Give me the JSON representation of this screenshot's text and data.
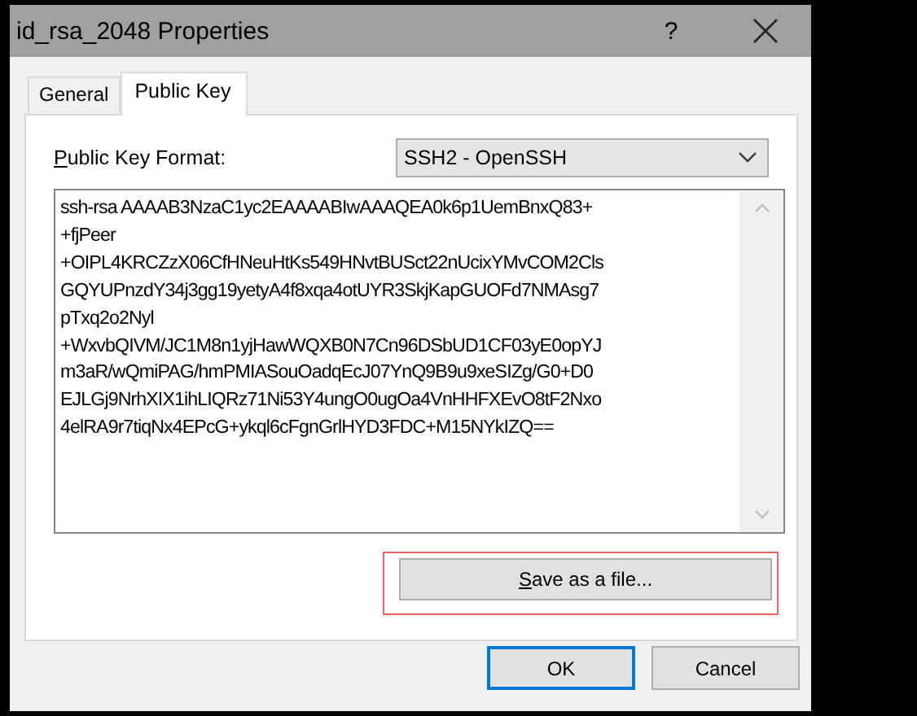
{
  "window": {
    "title": "id_rsa_2048 Properties",
    "help_button": "?"
  },
  "tabs": [
    {
      "label": "General",
      "selected": false
    },
    {
      "label": "Public Key",
      "selected": true
    }
  ],
  "format": {
    "label": "Public Key Format:",
    "value": "SSH2 - OpenSSH"
  },
  "key_text": {
    "lines": [
      "ssh-rsa AAAAB3NzaC1yc2EAAAABIwAAAQEA0k6p1UemBnxQ83+",
      "+fjPeer",
      "+OIPL4KRCZzX06CfHNeuHtKs549HNvtBUSct22nUcixYMvCOM2Cls",
      "GQYUPnzdY34j3gg19yetyA4f8xqa4otUYR3SkjKapGUOFd7NMAsg7",
      "pTxq2o2Nyl",
      "+WxvbQIVM/JC1M8n1yjHawWQXB0N7Cn96DSbUD1CF03yE0opYJ",
      "m3aR/wQmiPAG/hmPMIASouOadqEcJ07YnQ9B9u9xeSIZg/G0+D0",
      "EJLGj9NrhXIX1ihLIQRz71Ni53Y4ungO0ugOa4VnHHFXEvO8tF2Nxo",
      "4elRA9r7tiqNx4EPcG+ykql6cFgnGrlHYD3FDC+M15NYkIZQ=="
    ]
  },
  "save_button": {
    "label": "Save as a file...",
    "highlighted": true
  },
  "buttons": [
    {
      "label": "OK",
      "default": true
    },
    {
      "label": "Cancel",
      "default": false
    }
  ]
}
